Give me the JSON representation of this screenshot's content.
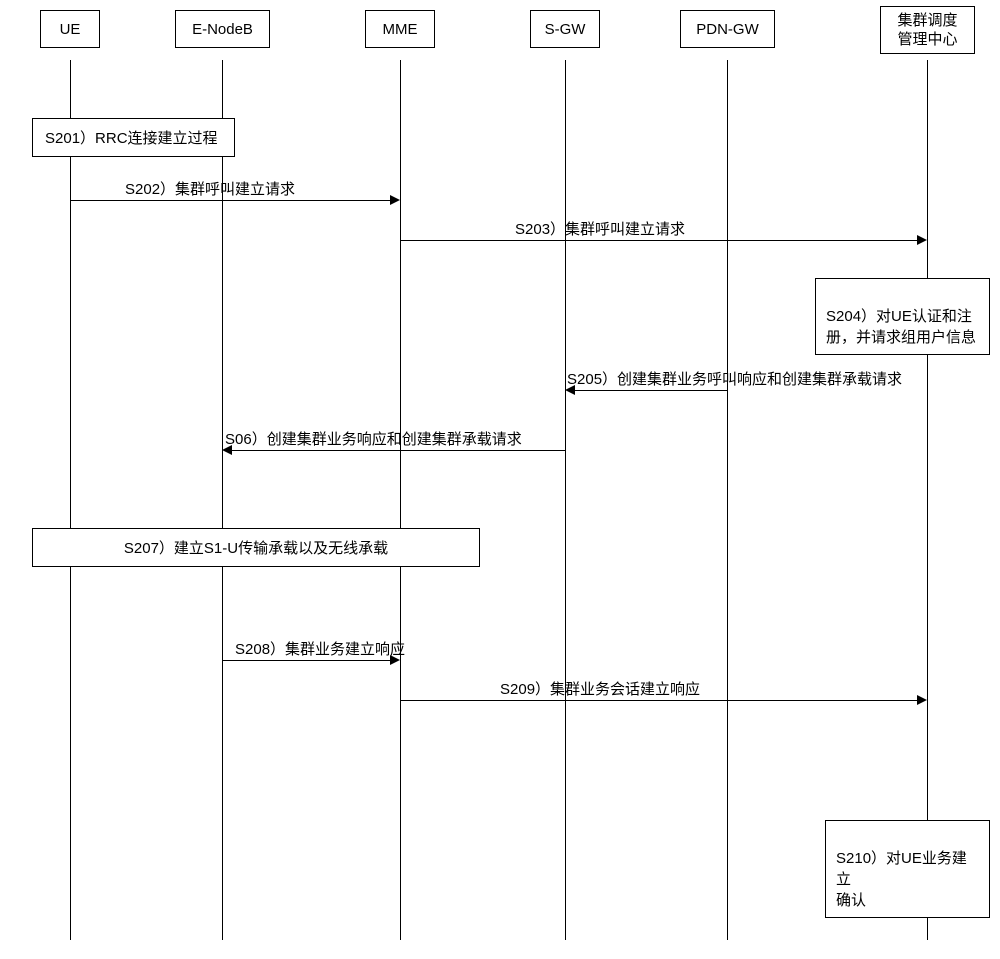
{
  "participants": {
    "ue": "UE",
    "enodeb": "E-NodeB",
    "mme": "MME",
    "sgw": "S-GW",
    "pdngw": "PDN-GW",
    "center": "集群调度\n管理中心"
  },
  "steps": {
    "s201": "S201）RRC连接建立过程",
    "s202": "S202）集群呼叫建立请求",
    "s203": "S203）集群呼叫建立请求",
    "s204": "S204）对UE认证和注\n册，并请求组用户信息",
    "s205": "S205）创建集群业务呼叫响应和创建集群承载请求",
    "s206": "S06）创建集群业务响应和创建集群承载请求",
    "s207": "S207）建立S1-U传输承载以及无线承载",
    "s208": "S208）集群业务建立响应",
    "s209": "S209）集群业务会话建立响应",
    "s210": "S210）对UE业务建立\n确认"
  },
  "chart_data": {
    "type": "sequence_diagram",
    "participants": [
      "UE",
      "E-NodeB",
      "MME",
      "S-GW",
      "PDN-GW",
      "集群调度管理中心"
    ],
    "messages": [
      {
        "id": "S201",
        "from": "UE",
        "to": "E-NodeB",
        "type": "activation_box",
        "text": "RRC连接建立过程"
      },
      {
        "id": "S202",
        "from": "UE",
        "to": "MME",
        "type": "message_right",
        "text": "集群呼叫建立请求"
      },
      {
        "id": "S203",
        "from": "MME",
        "to": "集群调度管理中心",
        "type": "message_right",
        "text": "集群呼叫建立请求"
      },
      {
        "id": "S204",
        "at": "集群调度管理中心",
        "type": "self_action",
        "text": "对UE认证和注册，并请求组用户信息"
      },
      {
        "id": "S205",
        "from": "PDN-GW",
        "to": "S-GW",
        "type": "message_left",
        "text": "创建集群业务呼叫响应和创建集群承载请求"
      },
      {
        "id": "S206",
        "from": "S-GW",
        "to": "E-NodeB",
        "type": "message_left",
        "text": "创建集群业务响应和创建集群承载请求"
      },
      {
        "id": "S207",
        "from": "UE",
        "to": "S-GW",
        "type": "activation_box",
        "text": "建立S1-U传输承载以及无线承载"
      },
      {
        "id": "S208",
        "from": "E-NodeB",
        "to": "MME",
        "type": "message_right",
        "text": "集群业务建立响应"
      },
      {
        "id": "S209",
        "from": "MME",
        "to": "集群调度管理中心",
        "type": "message_right",
        "text": "集群业务会话建立响应"
      },
      {
        "id": "S210",
        "at": "集群调度管理中心",
        "type": "self_action",
        "text": "对UE业务建立确认"
      }
    ]
  }
}
